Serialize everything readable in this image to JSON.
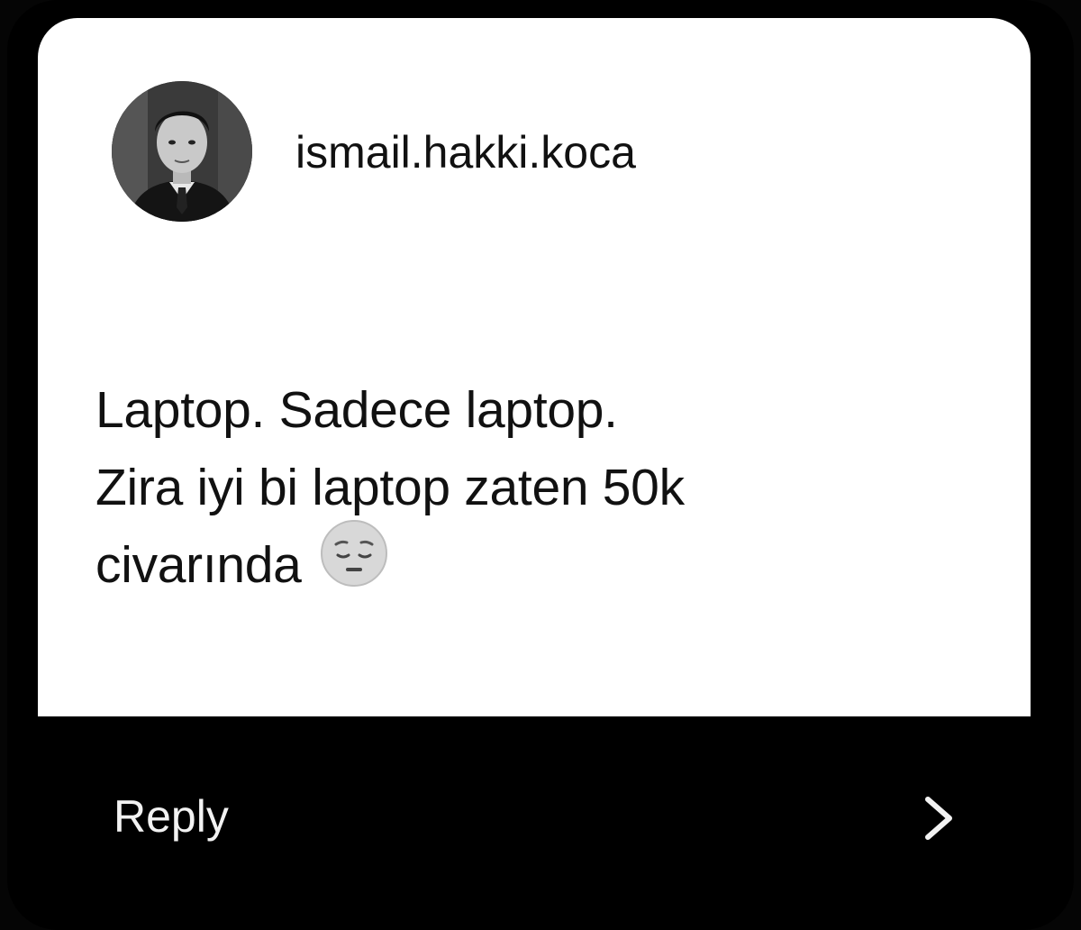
{
  "notification": {
    "username": "ismail.hakki.koca",
    "message_lines": [
      "Laptop. Sadece laptop.",
      "Zira iyi bi laptop zaten 50k",
      "civarında"
    ],
    "emoji": "pensive-face-emoji",
    "reply_label": "Reply",
    "chevron": "chevron-right-icon"
  },
  "colors": {
    "background": "#000000",
    "card": "#ffffff",
    "text_dark": "#111111",
    "text_light": "#f2f2f2"
  }
}
